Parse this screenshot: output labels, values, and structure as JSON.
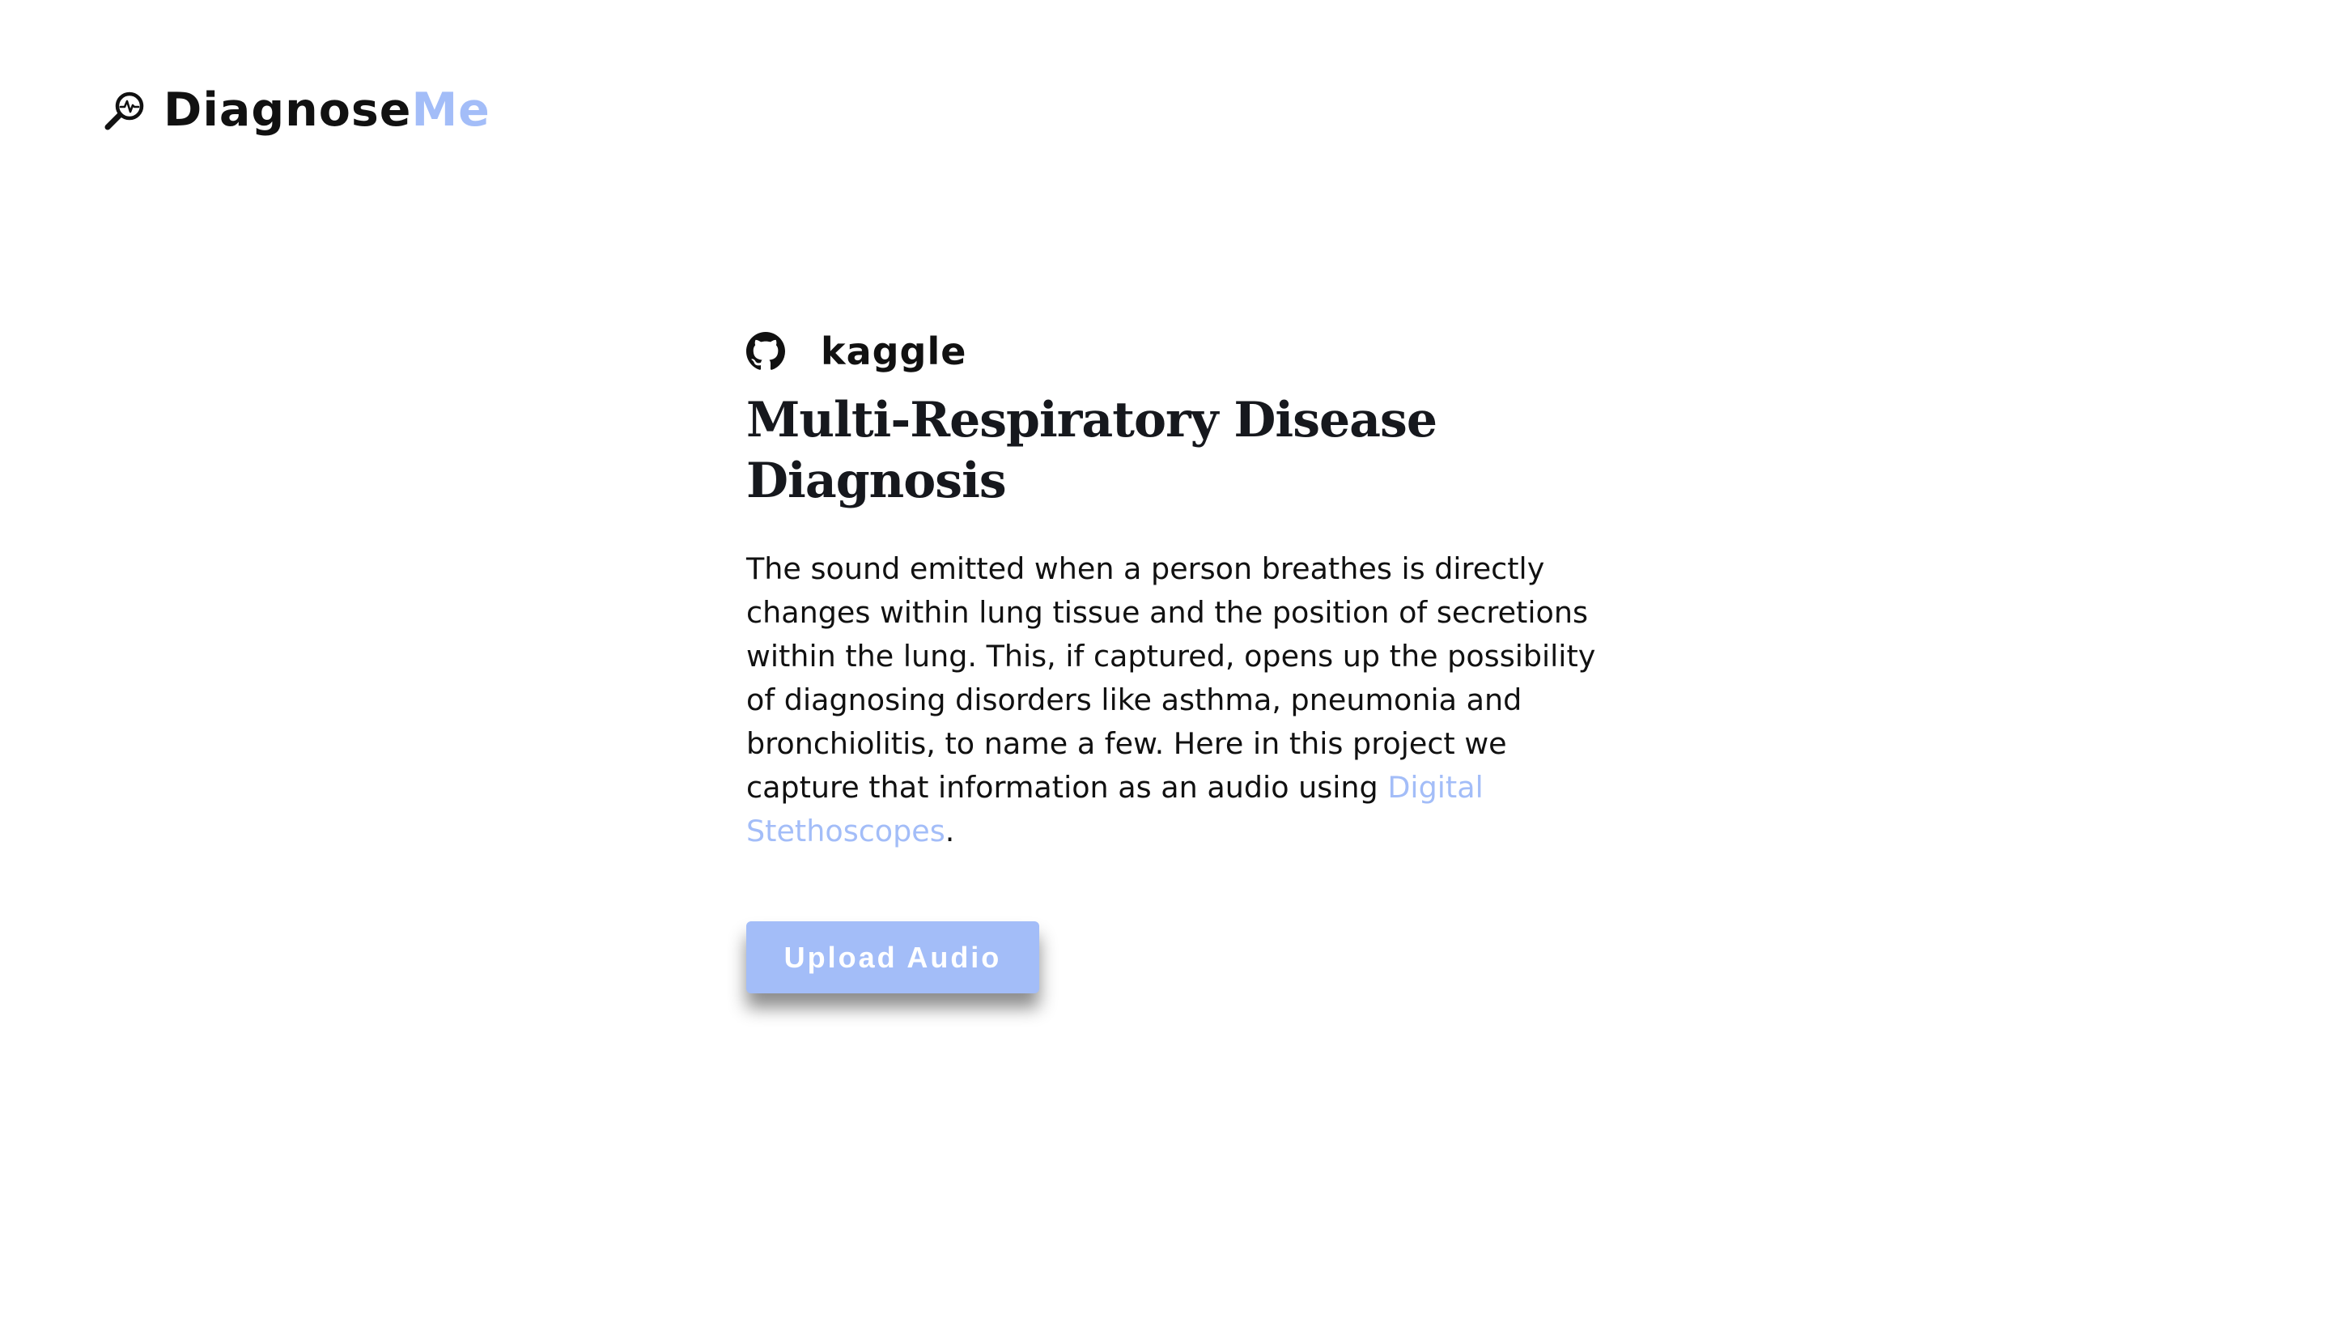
{
  "header": {
    "logo_primary": "Diagnose",
    "logo_accent": "Me",
    "logo_icon": "magnifier-pulse-icon"
  },
  "links": {
    "github_icon": "github-icon",
    "kaggle_label": "kaggle"
  },
  "main": {
    "title": "Multi-Respiratory Disease Diagnosis",
    "description_text": "The sound emitted when a person breathes is directly changes within lung tissue and the position of secretions within the lung. This, if captured, opens up the possibility of diagnosing disorders like asthma, pneumonia and bronchiolitis, to name a few. Here in this project we capture that information as an audio using ",
    "description_link": "Digital Stethoscopes",
    "description_end": ".",
    "upload_label": "Upload Audio"
  },
  "colors": {
    "accent": "#a3bdf8",
    "text": "#111111",
    "background": "#ffffff"
  }
}
